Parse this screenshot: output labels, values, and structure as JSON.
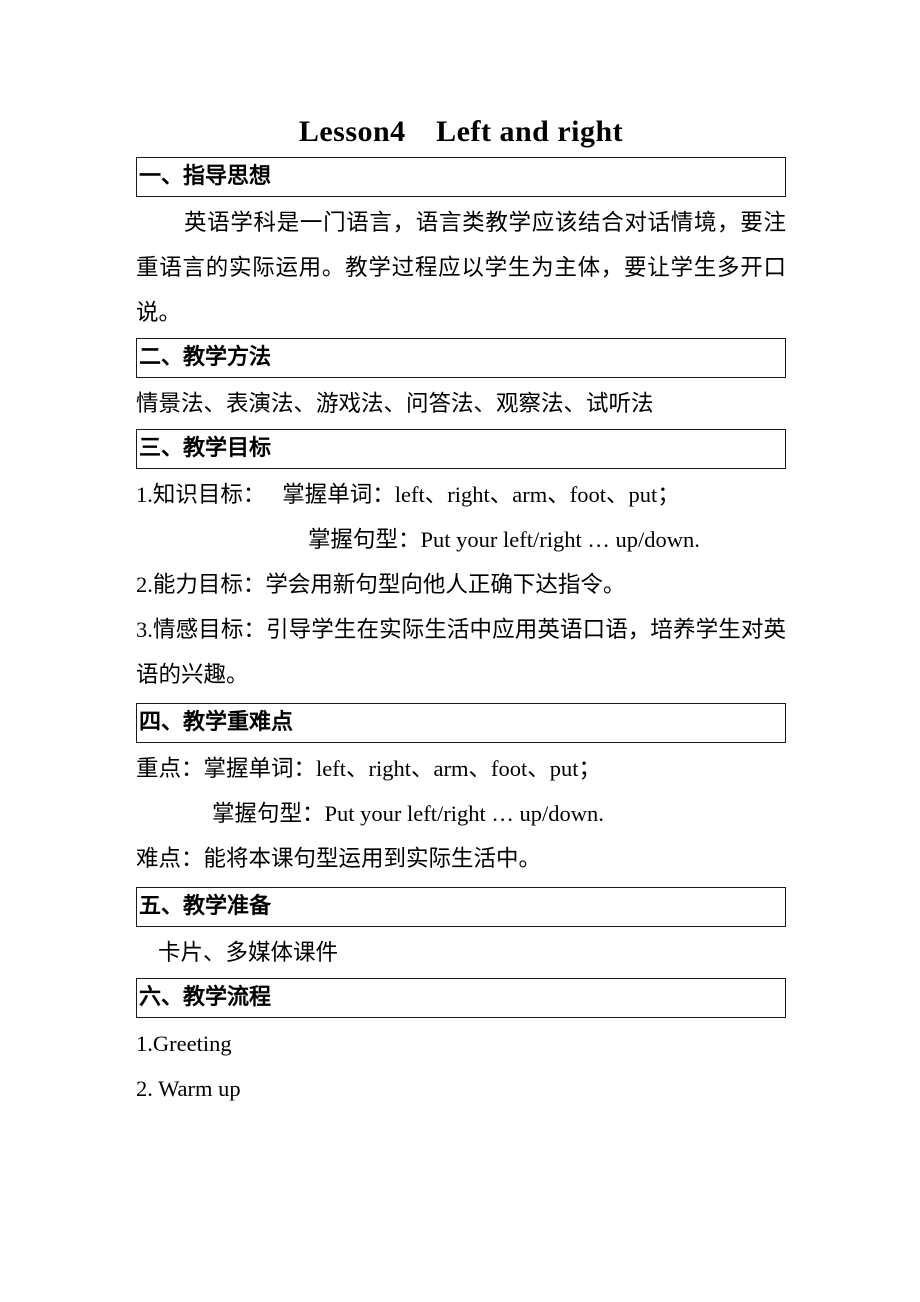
{
  "document": {
    "title": "Lesson4　Left and right",
    "sections": [
      {
        "heading": "一、指导思想",
        "body": "英语学科是一门语言，语言类教学应该结合对话情境，要注重语言的实际运用。教学过程应以学生为主体，要让学生多开口说。"
      },
      {
        "heading": "二、教学方法",
        "body": "情景法、表演法、游戏法、问答法、观察法、试听法"
      },
      {
        "heading": "三、教学目标",
        "goal1_label": "1.知识目标：",
        "goal1_words": "掌握单词：left、right、arm、foot、put；",
        "goal1_pattern": "掌握句型：Put your left/right … up/down.",
        "goal2": "2.能力目标：学会用新句型向他人正确下达指令。",
        "goal3": "3.情感目标：引导学生在实际生活中应用英语口语，培养学生对英语的兴趣。"
      },
      {
        "heading": "四、教学重难点",
        "key_point": "重点：掌握单词：left、right、arm、foot、put；",
        "key_point_pattern": "掌握句型：Put your left/right … up/down.",
        "difficult_point": "难点：能将本课句型运用到实际生活中。"
      },
      {
        "heading": "五、教学准备",
        "body": "卡片、多媒体课件"
      },
      {
        "heading": "六、教学流程",
        "step1": "1.Greeting",
        "step2": "2. Warm up"
      }
    ]
  }
}
